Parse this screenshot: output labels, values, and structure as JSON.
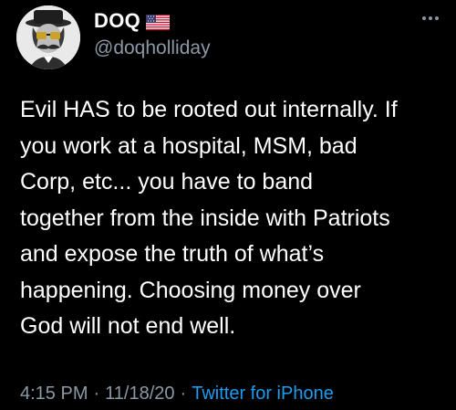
{
  "tweet": {
    "display_name": "DOQ",
    "handle": "@doqholliday",
    "body": "Evil HAS to be rooted out internally. If\nyou work at a hospital, MSM, bad\nCorp, etc... you have to band\ntogether from the inside with Patriots\nand expose the truth of what’s\nhappening. Choosing money over\nGod will not end well.",
    "time": "4:15 PM",
    "date": "11/18/20",
    "source": "Twitter for iPhone",
    "separator": "·",
    "icons": {
      "avatar": "avatar-mustache-man-icon",
      "flag": "us-flag-icon",
      "more": "more-dots-icon"
    },
    "colors": {
      "background": "#000000",
      "text": "#ffffff",
      "muted": "#8b98a5",
      "link": "#1d9bf0"
    }
  }
}
